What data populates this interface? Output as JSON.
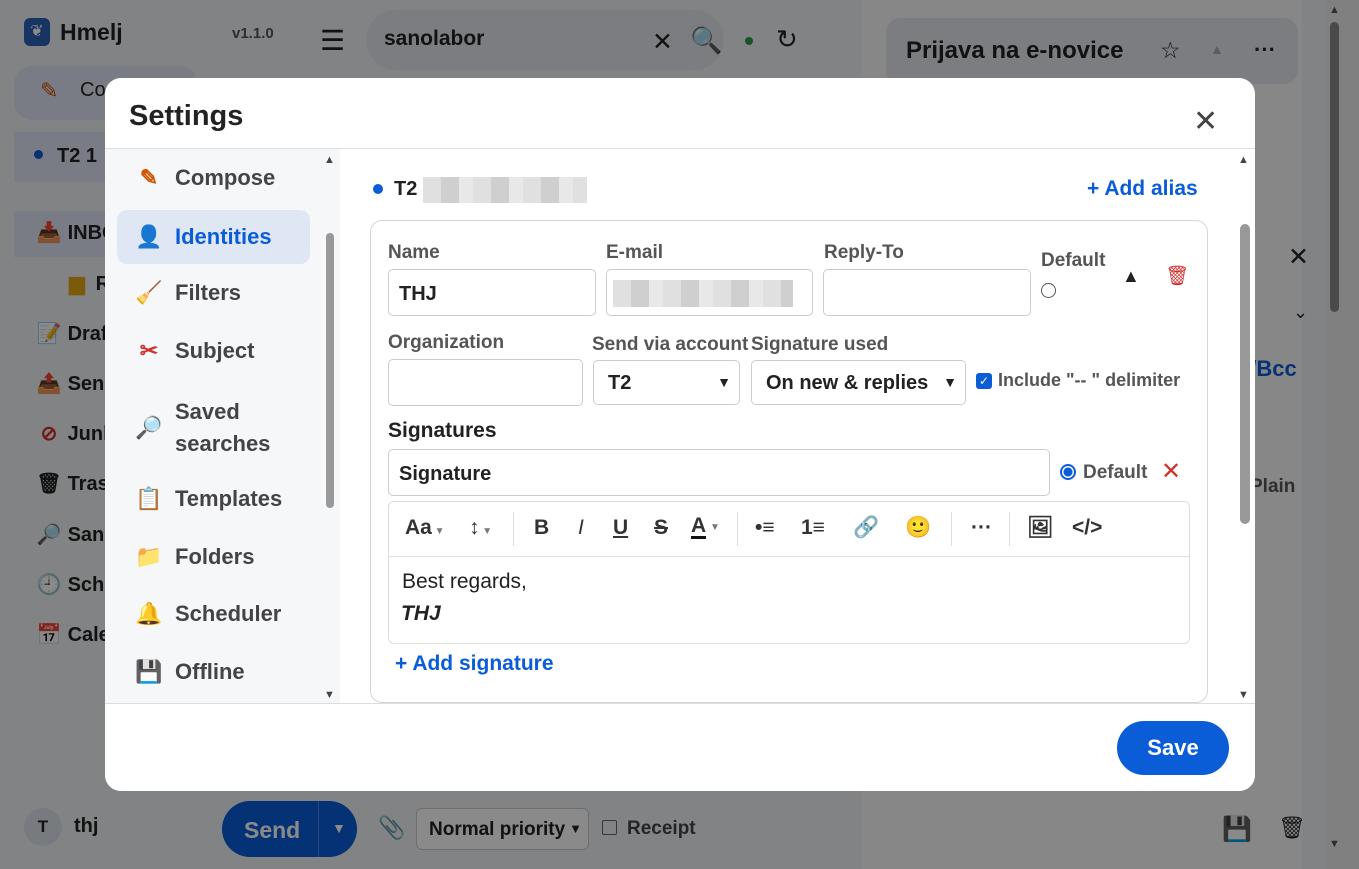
{
  "app": {
    "name": "Hmelj",
    "version": "v1.1.0",
    "logo_icon": "hop-cone-icon"
  },
  "sidebar": {
    "compose_label": "Co",
    "account_label": "T2  1",
    "items": [
      {
        "label": "INBO",
        "icon": "inbox-icon"
      },
      {
        "label": "Re",
        "icon": "folder-icon"
      },
      {
        "label": "Draf",
        "icon": "drafts-icon"
      },
      {
        "label": "Sen",
        "icon": "sent-icon"
      },
      {
        "label": "Junk",
        "icon": "junk-icon"
      },
      {
        "label": "Tras",
        "icon": "trash-icon"
      },
      {
        "label": "San",
        "icon": "saved-search-icon"
      },
      {
        "label": "Sch",
        "icon": "clock-icon"
      },
      {
        "label": "Cale",
        "icon": "calendar-icon"
      }
    ],
    "user_initial": "T",
    "user_name": "thj"
  },
  "search": {
    "value": "sanolabor"
  },
  "right_panel": {
    "title": "Prijava na e-novice",
    "cc_bcc": "c/Bcc",
    "plain": "Plain"
  },
  "compose_footer": {
    "send": "Send",
    "priority": "Normal priority",
    "receipt": "Receipt"
  },
  "settings": {
    "title": "Settings",
    "nav": [
      {
        "label": "Compose",
        "icon": "pencil-icon"
      },
      {
        "label": "Identities",
        "icon": "person-icon",
        "active": true
      },
      {
        "label": "Filters",
        "icon": "broom-icon"
      },
      {
        "label": "Subject",
        "icon": "scissors-icon"
      },
      {
        "label": "Saved",
        "label2": "searches",
        "icon": "magnifier-icon"
      },
      {
        "label": "Templates",
        "icon": "clipboard-icon"
      },
      {
        "label": "Folders",
        "icon": "folder-icon"
      },
      {
        "label": "Scheduler",
        "icon": "bell-icon"
      },
      {
        "label": "Offline",
        "icon": "floppy-disk-icon"
      }
    ],
    "identity_header": "T2",
    "add_alias": "+ Add alias",
    "labels": {
      "name": "Name",
      "email": "E-mail",
      "reply_to": "Reply-To",
      "default": "Default",
      "organization": "Organization",
      "send_via": "Send via account",
      "signature_used": "Signature used",
      "include_delim": "Include \"-- \" delimiter",
      "signatures": "Signatures"
    },
    "values": {
      "name": "THJ",
      "reply_to": "",
      "organization": "",
      "send_via": "T2",
      "signature_used": "On new & replies",
      "signature_name": "Signature",
      "sig_default": "Default"
    },
    "toolbar": {
      "font": "Aa",
      "bold": "B",
      "italic": "I",
      "underline": "U",
      "strike": "S",
      "color": "A",
      "more": "···",
      "code": "</>"
    },
    "editor": {
      "line1": "Best regards,",
      "line2": "THJ"
    },
    "add_signature": "+ Add signature",
    "save": "Save"
  },
  "colors": {
    "accent": "#0b5dd7",
    "danger": "#d0312d"
  }
}
